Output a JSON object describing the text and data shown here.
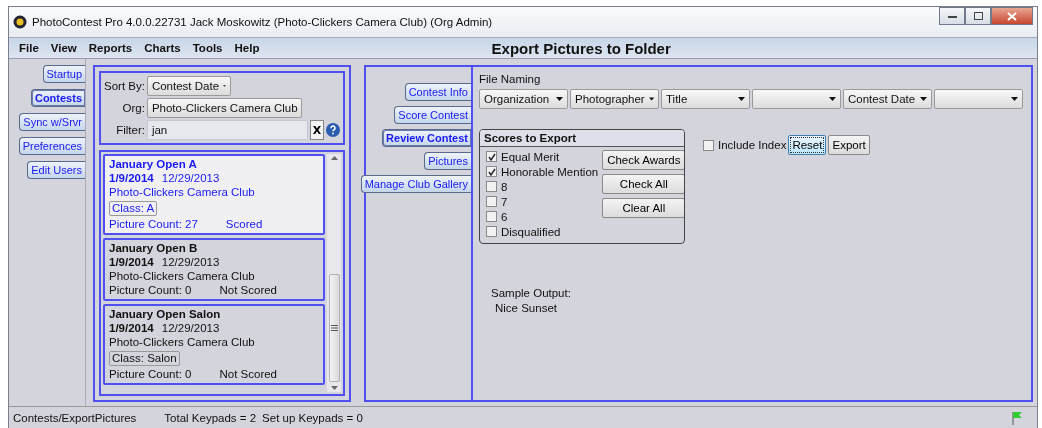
{
  "window": {
    "title": "PhotoContest Pro 4.0.0.22731 Jack Moskowitz (Photo-Clickers Camera Club) (Org Admin)"
  },
  "menu": [
    "File",
    "View",
    "Reports",
    "Charts",
    "Tools",
    "Help"
  ],
  "page_title": "Export Pictures to Folder",
  "nav_tabs": [
    {
      "label": "Startup",
      "selected": false
    },
    {
      "label": "Contests",
      "selected": true
    },
    {
      "label": "Sync w/Srvr",
      "selected": false
    },
    {
      "label": "Preferences",
      "selected": false
    },
    {
      "label": "Edit Users",
      "selected": false
    }
  ],
  "filters": {
    "sort_by": {
      "label": "Sort By:",
      "value": "Contest Date"
    },
    "org": {
      "label": "Org:",
      "value": "Photo-Clickers Camera Club"
    },
    "filter": {
      "label": "Filter:",
      "value": "jan"
    },
    "clear_button": "X"
  },
  "contests": [
    {
      "name": "January Open A",
      "date": "1/9/2014",
      "date_2": "12/29/2013",
      "org": "Photo-Clickers Camera Club",
      "class": "Class: A",
      "picture_count": "Picture Count: 27",
      "status": "Scored",
      "selected": true
    },
    {
      "name": "January Open B",
      "date": "1/9/2014",
      "date_2": "12/29/2013",
      "org": "Photo-Clickers Camera Club",
      "picture_count": "Picture Count: 0",
      "status": "Not Scored",
      "selected": false
    },
    {
      "name": "January Open Salon",
      "date": "1/9/2014",
      "date_2": "12/29/2013",
      "org": "Photo-Clickers Camera Club",
      "class": "Class: Salon",
      "picture_count": "Picture Count: 0",
      "status": "Not Scored",
      "selected": false
    }
  ],
  "sub_tabs": [
    {
      "label": "Contest Info",
      "selected": false
    },
    {
      "label": "Score Contest",
      "selected": false
    },
    {
      "label": "Review Contest",
      "selected": true
    },
    {
      "label": "Pictures",
      "selected": false
    },
    {
      "label": "Manage Club Gallery",
      "selected": false
    }
  ],
  "file_naming": {
    "label": "File Naming",
    "fields": [
      {
        "kind": "chosen",
        "value": "Organization"
      },
      {
        "kind": "chosen",
        "value": "Photographer"
      },
      {
        "kind": "chosen",
        "value": "Title"
      },
      {
        "kind": "blank"
      },
      {
        "kind": "chosen",
        "value": "Contest Date"
      },
      {
        "kind": "blank"
      }
    ]
  },
  "scores_to_export": {
    "title": "Scores to Export",
    "options": [
      {
        "label": "Equal Merit",
        "checked": true
      },
      {
        "label": "Honorable Mention",
        "checked": true
      },
      {
        "label": "8",
        "checked": false
      },
      {
        "label": "7",
        "checked": false
      },
      {
        "label": "6",
        "checked": false
      },
      {
        "label": "Disqualified",
        "checked": false
      }
    ],
    "buttons": [
      "Check Awards",
      "Check All",
      "Clear All"
    ]
  },
  "include_index": {
    "label": "Include Index",
    "checked": false
  },
  "actions": [
    {
      "label": "Reset",
      "focused": true
    },
    {
      "label": "Export",
      "focused": false
    }
  ],
  "sample_output": {
    "label": "Sample Output:",
    "value": "Nice Sunset"
  },
  "status_bar": {
    "path": "Contests/ExportPictures",
    "keypads": "Total Keypads = 2",
    "setup_keypads": "Set up Keypads = 0"
  }
}
